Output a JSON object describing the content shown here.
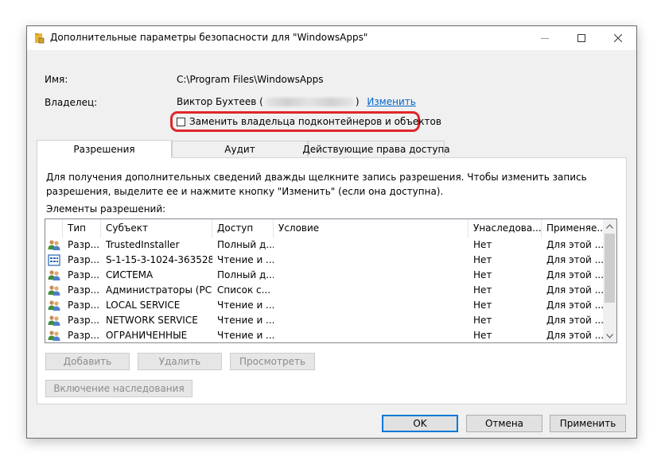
{
  "window": {
    "title": "Дополнительные параметры безопасности  для \"WindowsApps\""
  },
  "info": {
    "name_label": "Имя:",
    "name_value": "C:\\Program Files\\WindowsApps",
    "owner_label": "Владелец:",
    "owner_name": "Виктор Бухтеев (",
    "owner_close": ")",
    "change_link": "Изменить",
    "replace_owner_checkbox": "Заменить владельца подконтейнеров и объектов",
    "replace_owner_checked": false
  },
  "tabs": [
    {
      "label": "Разрешения",
      "active": true
    },
    {
      "label": "Аудит",
      "active": false
    },
    {
      "label": "Действующие права доступа",
      "active": false
    }
  ],
  "permissions": {
    "description": "Для получения дополнительных сведений дважды щелкните запись разрешения. Чтобы изменить запись разрешения, выделите ее и нажмите кнопку \"Изменить\" (если она доступна).",
    "entries_label": "Элементы разрешений:",
    "columns": [
      "Тип",
      "Субъект",
      "Доступ",
      "Условие",
      "Унаследова...",
      "Применяе..."
    ],
    "rows": [
      {
        "icon": "users-icon",
        "type": "Разр...",
        "principal": "TrustedInstaller",
        "access": "Полный д...",
        "condition": "",
        "inherited": "Нет",
        "applies": "Для этой ..."
      },
      {
        "icon": "app-package-icon",
        "type": "Разр...",
        "principal": "S-1-15-3-1024-363528...",
        "access": "Чтение и ...",
        "condition": "",
        "inherited": "Нет",
        "applies": "Для этой ..."
      },
      {
        "icon": "users-icon",
        "type": "Разр...",
        "principal": "СИСТЕМА",
        "access": "Полный д...",
        "condition": "",
        "inherited": "Нет",
        "applies": "Для этой ..."
      },
      {
        "icon": "users-icon",
        "type": "Разр...",
        "principal": "Администраторы (PC...",
        "access": "Список с...",
        "condition": "",
        "inherited": "Нет",
        "applies": "Для этой ..."
      },
      {
        "icon": "users-icon",
        "type": "Разр...",
        "principal": "LOCAL SERVICE",
        "access": "Чтение и ...",
        "condition": "",
        "inherited": "Нет",
        "applies": "Для этой ..."
      },
      {
        "icon": "users-icon",
        "type": "Разр...",
        "principal": "NETWORK SERVICE",
        "access": "Чтение и ...",
        "condition": "",
        "inherited": "Нет",
        "applies": "Для этой ..."
      },
      {
        "icon": "users-icon",
        "type": "Разр...",
        "principal": "ОГРАНИЧЕННЫЕ",
        "access": "Чтение и ...",
        "condition": "",
        "inherited": "Нет",
        "applies": "Для этой ..."
      }
    ],
    "buttons": {
      "add": "Добавить",
      "remove": "Удалить",
      "view": "Просмотреть",
      "enable_inheritance": "Включение наследования"
    }
  },
  "footer": {
    "ok": "OK",
    "cancel": "Отмена",
    "apply": "Применить"
  },
  "colors": {
    "highlight": "#e0262b",
    "link": "#0066cc",
    "default_button_border": "#0078d7"
  }
}
